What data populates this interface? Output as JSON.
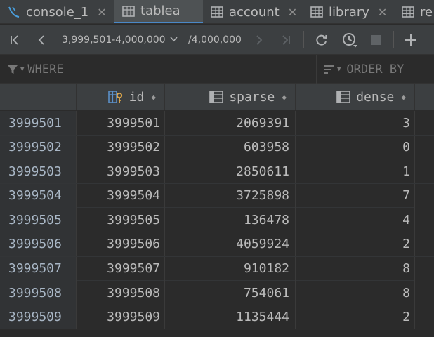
{
  "tabs": [
    {
      "label": "console_1",
      "icon": "console-icon",
      "active": false
    },
    {
      "label": "tablea",
      "icon": "table-icon",
      "active": true
    },
    {
      "label": "account",
      "icon": "table-icon",
      "active": false
    },
    {
      "label": "library",
      "icon": "table-icon",
      "active": false
    },
    {
      "label": "re",
      "icon": "table-icon",
      "active": false
    }
  ],
  "toolbar": {
    "page_range": "3,999,501-4,000,000",
    "total": "/4,000,000"
  },
  "filter": {
    "where_placeholder": "WHERE",
    "order_placeholder": "ORDER BY"
  },
  "columns": [
    {
      "label": "id",
      "icon": "primary-key-column-icon"
    },
    {
      "label": "sparse",
      "icon": "column-icon"
    },
    {
      "label": "dense",
      "icon": "column-icon"
    }
  ],
  "rows": [
    {
      "num": "3999501",
      "id": "3999501",
      "sparse": "2069391",
      "dense": "3"
    },
    {
      "num": "3999502",
      "id": "3999502",
      "sparse": "603958",
      "dense": "0"
    },
    {
      "num": "3999503",
      "id": "3999503",
      "sparse": "2850611",
      "dense": "1"
    },
    {
      "num": "3999504",
      "id": "3999504",
      "sparse": "3725898",
      "dense": "7"
    },
    {
      "num": "3999505",
      "id": "3999505",
      "sparse": "136478",
      "dense": "4"
    },
    {
      "num": "3999506",
      "id": "3999506",
      "sparse": "4059924",
      "dense": "2"
    },
    {
      "num": "3999507",
      "id": "3999507",
      "sparse": "910182",
      "dense": "8"
    },
    {
      "num": "3999508",
      "id": "3999508",
      "sparse": "754061",
      "dense": "8"
    },
    {
      "num": "3999509",
      "id": "3999509",
      "sparse": "1135444",
      "dense": "2"
    }
  ],
  "colors": {
    "accent": "#4a88c7",
    "background": "#2b2b2b",
    "panel": "#3c3f41"
  }
}
